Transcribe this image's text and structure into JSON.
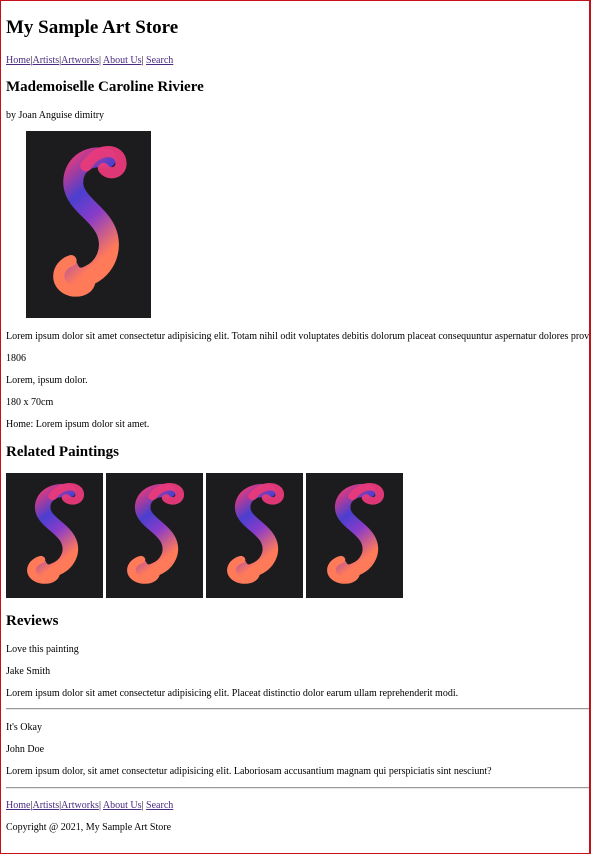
{
  "site": {
    "title": "My Sample Art Store"
  },
  "nav": {
    "home": "Home",
    "artists": "Artists",
    "artworks": "Artworks",
    "about": "About Us",
    "search": "Search",
    "separator": "|"
  },
  "painting": {
    "title": "Mademoiselle Caroline Riviere",
    "byline": "by Joan Anguise dimitry",
    "description": "Lorem ipsum dolor sit amet consectetur adipisicing elit. Totam nihil odit voluptates debitis dolorum placeat consequuntur aspernatur dolores provident",
    "year": "1806",
    "medium": "Lorem, ipsum dolor.",
    "size": "180 x 70cm",
    "home": "Home: Lorem ipsum dolor sit amet."
  },
  "related": {
    "heading": "Related Paintings",
    "count": 4
  },
  "reviews": {
    "heading": "Reviews",
    "items": [
      {
        "title": "Love this painting",
        "author": "Jake Smith",
        "body": "Lorem ipsum dolor sit amet consectetur adipisicing elit. Placeat distinctio dolor earum ullam reprehenderit modi."
      },
      {
        "title": "It's Okay",
        "author": "John Doe",
        "body": "Lorem ipsum dolor, sit amet consectetur adipisicing elit. Laboriosam accusantium magnam qui perspiciatis sint nesciunt?"
      }
    ]
  },
  "footer": {
    "copyright": "Copyright @ 2021, My Sample Art Store"
  },
  "colors": {
    "border": "#c4101a",
    "link": "#4b2a82",
    "art_background": "#1c1c1e",
    "art_gradient": [
      "#ff7a59",
      "#e83a7a",
      "#8a3cc8",
      "#4a3fd0"
    ]
  },
  "icons": {
    "artwork": "s-shape-gradient-icon"
  }
}
